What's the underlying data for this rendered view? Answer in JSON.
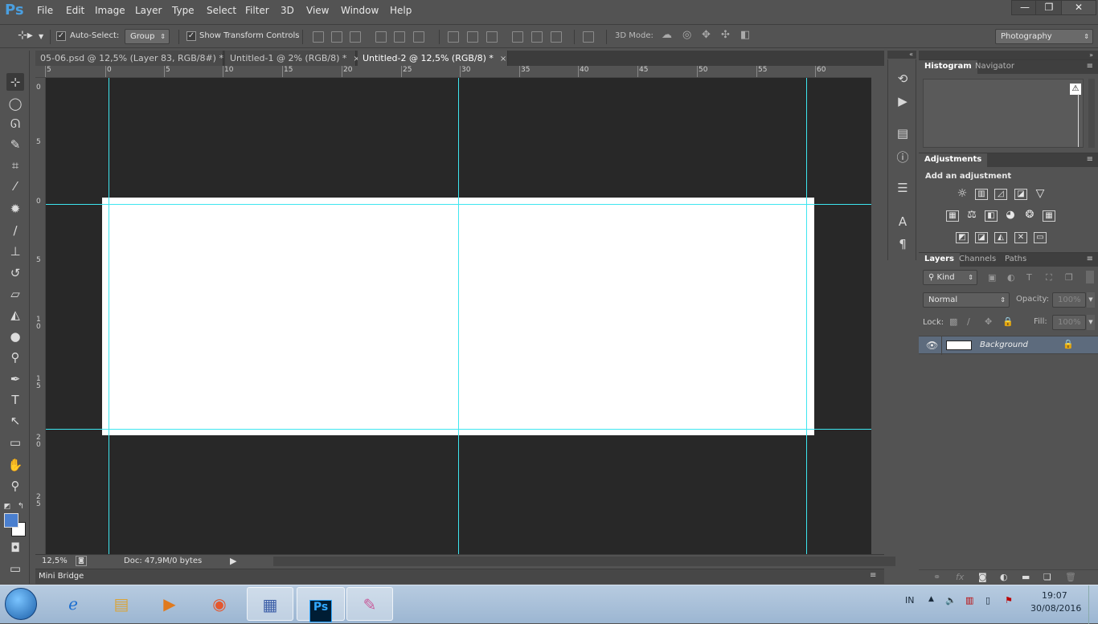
{
  "app": {
    "logo": "Ps"
  },
  "menu": [
    "File",
    "Edit",
    "Image",
    "Layer",
    "Type",
    "Select",
    "Filter",
    "3D",
    "View",
    "Window",
    "Help"
  ],
  "window_controls": {
    "minimize": "—",
    "restore": "❐",
    "close": "✕"
  },
  "options_bar": {
    "auto_select_label": "Auto-Select:",
    "auto_select_checked": "✓",
    "group_value": "Group",
    "show_transform_label": "Show Transform Controls",
    "show_transform_checked": "✓",
    "mode_3d_label": "3D Mode:",
    "workspace": "Photography"
  },
  "tabs": [
    {
      "label": "05-06.psd @ 12,5% (Layer 83, RGB/8#) *",
      "close": "×"
    },
    {
      "label": "Untitled-1 @ 2% (RGB/8) *",
      "close": "×"
    },
    {
      "label": "Untitled-2 @ 12,5% (RGB/8) *",
      "close": "×"
    }
  ],
  "ruler_top": [
    "5",
    "0",
    "5",
    "10",
    "15",
    "20",
    "25",
    "30",
    "35",
    "40",
    "45",
    "50",
    "55",
    "60"
  ],
  "ruler_left": [
    "0",
    "5",
    "0",
    "5",
    "10",
    "15",
    "20",
    "25"
  ],
  "status": {
    "zoom": "12,5%",
    "doc": "Doc: 47,9M/0 bytes",
    "arrow": "▶"
  },
  "mini_bridge": "Mini Bridge",
  "panels": {
    "histogram": {
      "tabs": [
        "Histogram",
        "Navigator"
      ],
      "warning": "⚠"
    },
    "adjustments": {
      "tab": "Adjustments",
      "heading": "Add an adjustment"
    },
    "layers": {
      "tabs": [
        "Layers",
        "Channels",
        "Paths"
      ],
      "filter_kind": "Kind",
      "blend_mode": "Normal",
      "opacity_label": "Opacity:",
      "opacity_value": "100%",
      "lock_label": "Lock:",
      "fill_label": "Fill:",
      "fill_value": "100%",
      "layer_name": "Background",
      "bottom_icons": [
        "⚭",
        "fx",
        "◙",
        "◐",
        "▬",
        "❏",
        "🗑"
      ]
    }
  },
  "taskbar": {
    "lang": "IN",
    "time": "19:07",
    "date": "30/08/2016"
  },
  "colors": {
    "guide": "#3ee6f0",
    "foreground": "#4a7fcf",
    "background_swatch": "#ffffff"
  }
}
